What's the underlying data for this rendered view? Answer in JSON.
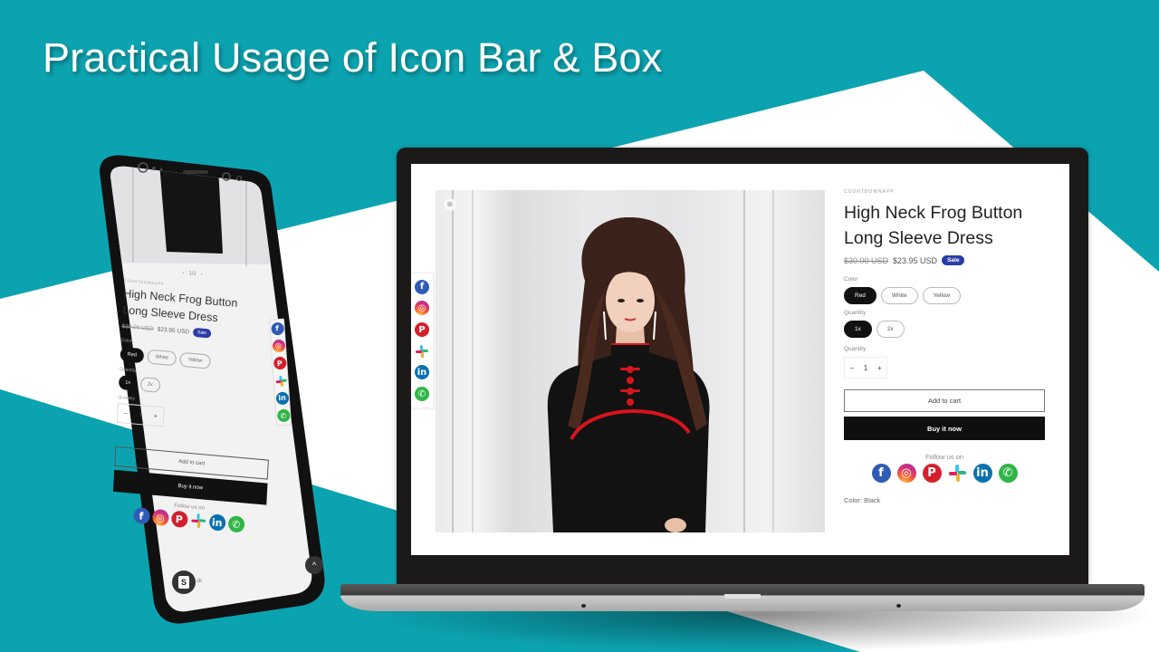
{
  "headline": "Practical Usage of Icon Bar & Box",
  "colors": {
    "background_teal": "#0ca3b0",
    "sale_badge": "#2b3ea6",
    "buy_button": "#0f0f0f"
  },
  "icons": [
    "facebook-icon",
    "instagram-icon",
    "pinterest-icon",
    "slack-icon",
    "linkedin-icon",
    "whatsapp-icon"
  ],
  "icon_glyphs": {
    "facebook": "f",
    "instagram": "◎",
    "pinterest": "P",
    "linkedin": "in",
    "whatsapp": "✆"
  },
  "desktop": {
    "zoom_glyph": "⊕",
    "product": {
      "vendor": "COUNTDOWNAPP",
      "title": "High Neck Frog Button Long Sleeve Dress",
      "compare_price": "$30.00 USD",
      "price": "$23.95 USD",
      "badge": "Sale",
      "color_label": "Color",
      "colors": [
        "Red",
        "White",
        "Yellow"
      ],
      "selected_color": "Red",
      "pack_label": "Quantity",
      "packs": [
        "1x",
        "2x"
      ],
      "selected_pack": "1x",
      "quantity_label": "Quantity",
      "quantity": "1",
      "minus": "−",
      "plus": "+",
      "add_to_cart": "Add to cart",
      "buy_now": "Buy it now",
      "follow_label": "Follow us on",
      "color_note": "Color: Black"
    }
  },
  "mobile": {
    "pagination": "1/2",
    "prev": "‹",
    "next": "›",
    "vendor": "COUNTDOWNAPP",
    "title": "High Neck Frog Button Long Sleeve Dress",
    "compare_price": "$30.00 USD",
    "price": "$23.95 USD",
    "badge": "Sale",
    "color_label": "Color",
    "colors": [
      "Red",
      "White",
      "Yellow"
    ],
    "pack_label": "Quantity",
    "packs": [
      "1x",
      "2x"
    ],
    "quantity_label": "Quantity",
    "quantity": "1",
    "minus": "−",
    "plus": "+",
    "add_to_cart": "Add to cart",
    "buy_now": "Buy it now",
    "follow_label": "Follow us on",
    "scroll_top": "^",
    "shopify_glyph": "S",
    "footer_partial": "ck"
  }
}
